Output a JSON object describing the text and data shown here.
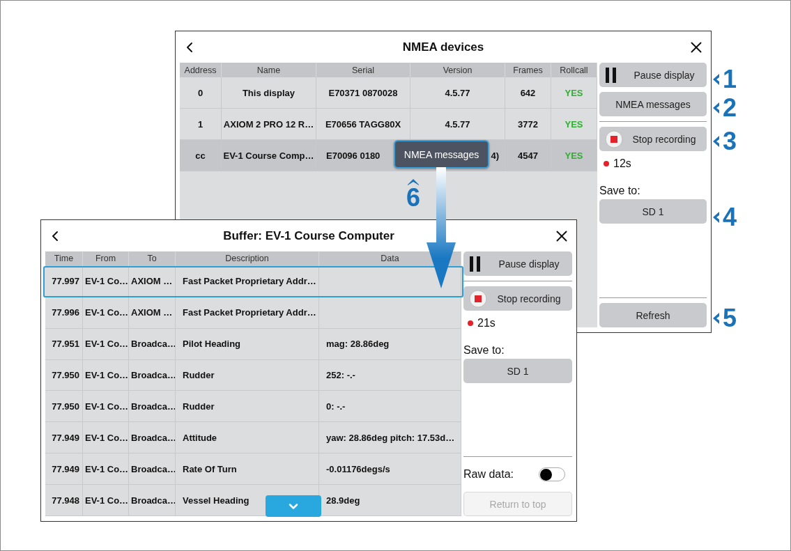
{
  "windows": [
    {
      "title": "NMEA devices",
      "columns": [
        "Address",
        "Name",
        "Serial",
        "Version",
        "Frames",
        "Rollcall"
      ],
      "rows": [
        {
          "selected": false,
          "cells": [
            "0",
            "This display",
            "E70371 0870028",
            "4.5.77",
            "642",
            "YES"
          ]
        },
        {
          "selected": false,
          "cells": [
            "1",
            "AXIOM 2 PRO 12 R…",
            "E70656 TAGG80X",
            "4.5.77",
            "3772",
            "YES"
          ]
        },
        {
          "selected": true,
          "cells": [
            "cc",
            "EV-1 Course Comp…",
            "E70096 0180",
            "4)",
            "4547",
            "YES"
          ],
          "tooltip": "NMEA messages"
        }
      ],
      "side": {
        "top": [
          {
            "kind": "pause",
            "label": "Pause display",
            "disabled": false
          },
          {
            "kind": "button",
            "label": "NMEA messages",
            "disabled": false
          },
          {
            "kind": "divider"
          },
          {
            "kind": "record",
            "label": "Stop recording",
            "disabled": false
          },
          {
            "kind": "status",
            "recording": true,
            "text": "12s"
          },
          {
            "kind": "label",
            "text": "Save to:"
          },
          {
            "kind": "button",
            "label": "SD 1",
            "disabled": false
          }
        ],
        "bottom": [
          {
            "kind": "divider"
          },
          {
            "kind": "button",
            "label": "Refresh",
            "disabled": false
          }
        ]
      }
    },
    {
      "title": "Buffer: EV-1 Course Computer",
      "columns": [
        "Time",
        "From",
        "To",
        "Description",
        "Data"
      ],
      "rows": [
        {
          "selected": true,
          "cells": [
            "77.997",
            "EV-1 Co…",
            "AXIOM …",
            "Fast Packet Proprietary Addr…",
            ""
          ]
        },
        {
          "selected": false,
          "cells": [
            "77.996",
            "EV-1 Co…",
            "AXIOM …",
            "Fast Packet Proprietary Addr…",
            ""
          ]
        },
        {
          "selected": false,
          "cells": [
            "77.951",
            "EV-1 Co…",
            "Broadca…",
            "Pilot Heading",
            "mag: 28.86deg"
          ]
        },
        {
          "selected": false,
          "cells": [
            "77.950",
            "EV-1 Co…",
            "Broadca…",
            "Rudder",
            "252: -.-"
          ]
        },
        {
          "selected": false,
          "cells": [
            "77.950",
            "EV-1 Co…",
            "Broadca…",
            "Rudder",
            "0: -.-"
          ]
        },
        {
          "selected": false,
          "cells": [
            "77.949",
            "EV-1 Co…",
            "Broadca…",
            "Attitude",
            "yaw: 28.86deg pitch: 17.53d…"
          ]
        },
        {
          "selected": false,
          "cells": [
            "77.949",
            "EV-1 Co…",
            "Broadca…",
            "Rate Of Turn",
            "-0.01176degs/s"
          ]
        },
        {
          "selected": false,
          "cells": [
            "77.948",
            "EV-1 Co…",
            "Broadca…",
            "Vessel Heading",
            "28.9deg"
          ]
        }
      ],
      "scroll_down": true,
      "side": {
        "top": [
          {
            "kind": "pause",
            "label": "Pause display",
            "disabled": false
          },
          {
            "kind": "divider"
          },
          {
            "kind": "record",
            "label": "Stop recording",
            "disabled": false
          },
          {
            "kind": "status",
            "recording": true,
            "text": "21s"
          },
          {
            "kind": "label",
            "text": "Save to:"
          },
          {
            "kind": "button",
            "label": "SD 1",
            "disabled": false
          }
        ],
        "bottom": [
          {
            "kind": "divider"
          },
          {
            "kind": "toggle",
            "label": "Raw data:",
            "on": false
          },
          {
            "kind": "button",
            "label": "Return to top",
            "disabled": true
          }
        ]
      }
    }
  ],
  "callouts": [
    {
      "label": "1"
    },
    {
      "label": "2"
    },
    {
      "label": "3"
    },
    {
      "label": "4"
    },
    {
      "label": "5"
    },
    {
      "label": "6"
    }
  ]
}
